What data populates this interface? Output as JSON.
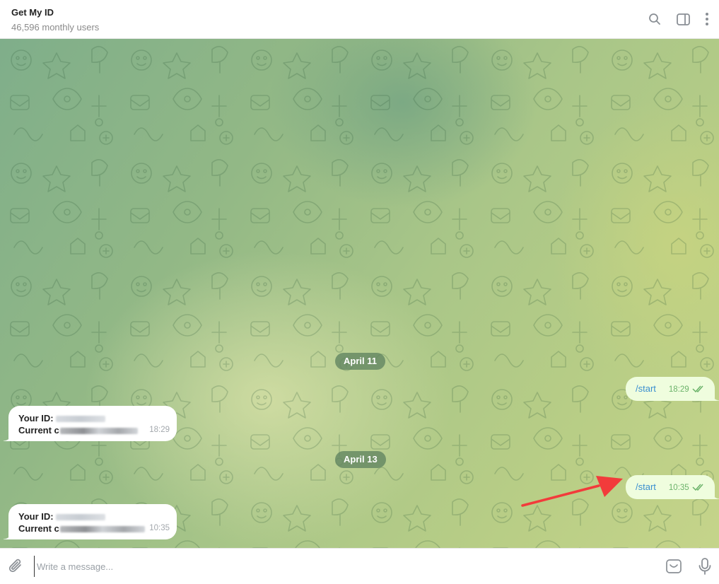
{
  "header": {
    "title": "Get My ID",
    "subtitle": "46,596 monthly users",
    "icons": [
      "search-icon",
      "sidebar-toggle-icon",
      "more-vertical-icon"
    ]
  },
  "chat": {
    "dates": [
      "April 11",
      "April 13"
    ],
    "messages": [
      {
        "direction": "out",
        "text": "/start",
        "time": "18:29",
        "status": "read"
      },
      {
        "direction": "in",
        "line1_label": "Your ID:",
        "line2_label": "Current c",
        "time": "18:29"
      },
      {
        "direction": "out",
        "text": "/start",
        "time": "10:35",
        "status": "read"
      },
      {
        "direction": "in",
        "line1_label": "Your ID:",
        "line2_label": "Current c",
        "time": "10:35"
      }
    ]
  },
  "composer": {
    "placeholder": "Write a message...",
    "icons": [
      "paperclip-icon",
      "emoji-icon",
      "microphone-icon"
    ]
  },
  "colors": {
    "outgoing_bubble": "#effdde",
    "command_link": "#3a8fd0",
    "read_check": "#6cb36a",
    "annotation_arrow": "#f23b3b"
  }
}
